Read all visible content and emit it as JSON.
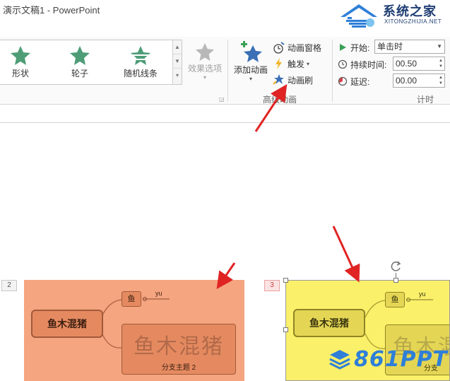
{
  "window": {
    "title": "演示文稿1 - PowerPoint"
  },
  "watermark_top": {
    "brand": "系统之家",
    "sub": "XITONGZHIJIA.NET"
  },
  "gallery": {
    "items": [
      {
        "label": "形状",
        "icon": "star-icon"
      },
      {
        "label": "轮子",
        "icon": "star-icon"
      },
      {
        "label": "随机线条",
        "icon": "striped-star-icon"
      }
    ]
  },
  "effect_options": {
    "label": "效果选项"
  },
  "advanced": {
    "add_animation": "添加动画",
    "animation_pane": "动画窗格",
    "trigger": "触发",
    "animation_painter": "动画刷",
    "group_label": "高级动画"
  },
  "timing": {
    "start_label": "开始:",
    "start_value": "单击时",
    "duration_label": "持续时间:",
    "duration_value": "00.50",
    "delay_label": "延迟:",
    "delay_value": "00.00",
    "group_label": "计时"
  },
  "slides": [
    {
      "number": "2",
      "main_topic": "鱼木混猪",
      "child": "鱼",
      "note": "yu",
      "big_text": "鱼木混猪",
      "branch": "分支主题 2",
      "bg_color": "#f5a57f"
    },
    {
      "number": "3",
      "main_topic": "鱼木混猪",
      "child": "鱼",
      "note": "yu",
      "big_text": "鱼木混",
      "branch": "分支",
      "bg_color": "#faf06a"
    }
  ],
  "watermark_bottom": {
    "text": "861PPT"
  },
  "colors": {
    "arrow": "#e02424",
    "accent_star": "#5aa37e",
    "brand_blue": "#2f7fd8"
  }
}
